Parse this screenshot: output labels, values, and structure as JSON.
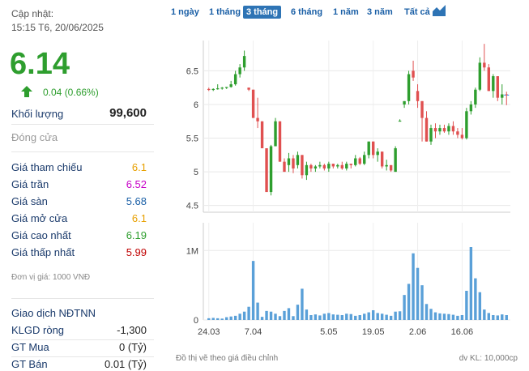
{
  "header": {
    "updated_label": "Cập nhật:",
    "updated_time": "15:15 T6, 20/06/2025",
    "price": "6.14",
    "change": "0.04 (0.66%)",
    "change_color": "#2e9e2e"
  },
  "volume": {
    "label": "Khối lượng",
    "value": "99,600"
  },
  "close_label": "Đóng cửa",
  "prices": [
    {
      "label": "Giá tham chiếu",
      "value": "6.1",
      "color": "#e8a000"
    },
    {
      "label": "Giá trần",
      "value": "6.52",
      "color": "#c800c8"
    },
    {
      "label": "Giá sàn",
      "value": "5.68",
      "color": "#1a5fa6"
    },
    {
      "label": "Giá mở cửa",
      "value": "6.1",
      "color": "#e8a000"
    },
    {
      "label": "Giá cao nhất",
      "value": "6.19",
      "color": "#2e9e2e"
    },
    {
      "label": "Giá thấp nhất",
      "value": "5.99",
      "color": "#c00000"
    }
  ],
  "unit_note": "Đơn vị giá: 1000 VNĐ",
  "foreign": {
    "title": "Giao dịch NĐTNN",
    "rows": [
      {
        "label": "KLGD ròng",
        "value": "-1,300"
      },
      {
        "label": "GT Mua",
        "value": "0 (Tỷ)"
      },
      {
        "label": "GT Bán",
        "value": "0.01 (Tỷ)"
      }
    ]
  },
  "tabs": [
    "1 ngày",
    "1 tháng",
    "3 tháng",
    "6 tháng",
    "1 năm",
    "3 năm",
    "Tất cả"
  ],
  "active_tab": "3 tháng",
  "chart_icon": "area-chart-icon",
  "footer": {
    "left": "Đồ thị vẽ theo giá điều chỉnh",
    "right": "dv KL: 10,000cp"
  },
  "colors": {
    "up": "#2e9e2e",
    "down": "#e05050",
    "ref": "#1a8cff",
    "volume": "#5aa0d8"
  },
  "chart_data": {
    "type": "candlestick",
    "price_axis": {
      "ticks": [
        "6.5",
        "6",
        "5.5",
        "5",
        "4.5"
      ],
      "tick_values": [
        6.5,
        6,
        5.5,
        5,
        4.5
      ],
      "ylim": [
        4.4,
        6.95
      ]
    },
    "volume_axis": {
      "ticks": [
        "1M",
        "0"
      ],
      "tick_values": [
        10000,
        0
      ],
      "ylim": [
        0,
        14000
      ]
    },
    "x_ticks": [
      {
        "label": "24.03",
        "index": 0
      },
      {
        "label": "7.04",
        "index": 10
      },
      {
        "label": "5.05",
        "index": 27
      },
      {
        "label": "19.05",
        "index": 37
      },
      {
        "label": "2.06",
        "index": 47
      },
      {
        "label": "16.06",
        "index": 57
      }
    ],
    "candles": [
      [
        6.23,
        6.25,
        6.2,
        6.22
      ],
      [
        6.22,
        6.24,
        6.2,
        6.23
      ],
      [
        6.23,
        6.3,
        6.22,
        6.24
      ],
      [
        6.24,
        6.26,
        6.22,
        6.25
      ],
      [
        6.25,
        6.26,
        6.23,
        6.26
      ],
      [
        6.26,
        6.35,
        6.25,
        6.3
      ],
      [
        6.3,
        6.5,
        6.28,
        6.45
      ],
      [
        6.45,
        6.6,
        6.4,
        6.55
      ],
      [
        6.55,
        6.8,
        6.5,
        6.72
      ],
      [
        6.25,
        6.25,
        6.2,
        6.22
      ],
      [
        6.22,
        6.22,
        5.8,
        5.8
      ],
      [
        5.8,
        6.1,
        5.65,
        5.75
      ],
      [
        5.75,
        5.75,
        5.35,
        5.35
      ],
      [
        5.35,
        5.35,
        4.7,
        4.7
      ],
      [
        4.7,
        5.4,
        4.65,
        5.38
      ],
      [
        5.38,
        5.8,
        5.38,
        5.75
      ],
      [
        5.75,
        5.75,
        5.15,
        5.15
      ],
      [
        5.15,
        5.2,
        5.0,
        5.0
      ],
      [
        5.1,
        5.28,
        5.0,
        5.2
      ],
      [
        5.2,
        5.25,
        4.98,
        5.05
      ],
      [
        5.1,
        5.3,
        5.05,
        5.25
      ],
      [
        5.25,
        5.25,
        4.9,
        4.95
      ],
      [
        4.95,
        5.15,
        4.88,
        5.1
      ],
      [
        5.1,
        5.12,
        5.0,
        5.05
      ],
      [
        5.05,
        5.1,
        5.0,
        5.08
      ],
      [
        5.08,
        5.15,
        5.05,
        5.1
      ],
      [
        5.1,
        5.12,
        5.02,
        5.05
      ],
      [
        5.05,
        5.15,
        5.0,
        5.12
      ],
      [
        5.12,
        5.12,
        5.05,
        5.08
      ],
      [
        5.08,
        5.12,
        5.05,
        5.1
      ],
      [
        5.1,
        5.15,
        5.03,
        5.05
      ],
      [
        5.05,
        5.15,
        5.02,
        5.12
      ],
      [
        5.12,
        5.12,
        5.05,
        5.1
      ],
      [
        5.1,
        5.25,
        5.08,
        5.2
      ],
      [
        5.2,
        5.22,
        5.1,
        5.12
      ],
      [
        5.12,
        5.3,
        5.1,
        5.25
      ],
      [
        5.25,
        5.45,
        5.2,
        5.45
      ],
      [
        5.45,
        5.45,
        5.2,
        5.25
      ],
      [
        5.25,
        5.35,
        5.15,
        5.3
      ],
      [
        5.3,
        5.3,
        5.05,
        5.08
      ],
      [
        5.08,
        5.18,
        5.02,
        5.1
      ],
      [
        5.1,
        5.08,
        5.0,
        5.02
      ],
      [
        5.0,
        5.38,
        5.0,
        5.35
      ],
      [
        5.75,
        5.78,
        5.75,
        5.76
      ],
      [
        6.0,
        6.05,
        5.95,
        6.05
      ],
      [
        6.05,
        6.5,
        6.0,
        6.45
      ],
      [
        6.5,
        6.65,
        6.35,
        6.4
      ],
      [
        6.2,
        6.3,
        5.95,
        6.05
      ],
      [
        6.05,
        6.05,
        5.45,
        5.8
      ],
      [
        5.8,
        5.9,
        5.45,
        5.45
      ],
      [
        5.45,
        5.7,
        5.4,
        5.65
      ],
      [
        5.65,
        5.72,
        5.5,
        5.6
      ],
      [
        5.6,
        5.7,
        5.55,
        5.65
      ],
      [
        5.65,
        5.7,
        5.58,
        5.6
      ],
      [
        5.6,
        5.72,
        5.55,
        5.68
      ],
      [
        5.68,
        5.75,
        5.55,
        5.6
      ],
      [
        5.6,
        5.65,
        5.5,
        5.55
      ],
      [
        5.55,
        5.65,
        5.48,
        5.5
      ],
      [
        5.5,
        5.95,
        5.48,
        5.9
      ],
      [
        5.9,
        6.05,
        5.85,
        6.0
      ],
      [
        6.0,
        6.25,
        5.95,
        6.22
      ],
      [
        6.22,
        6.7,
        6.2,
        6.62
      ],
      [
        6.62,
        6.9,
        6.5,
        6.55
      ],
      [
        6.55,
        6.6,
        6.2,
        6.2
      ],
      [
        6.2,
        6.45,
        6.1,
        6.42
      ],
      [
        6.42,
        6.42,
        6.05,
        6.1
      ],
      [
        6.1,
        6.3,
        6.0,
        6.15
      ],
      [
        6.15,
        6.19,
        5.99,
        6.14
      ]
    ],
    "volumes": [
      250,
      300,
      250,
      200,
      400,
      500,
      600,
      900,
      1200,
      1900,
      8500,
      2500,
      450,
      1300,
      1200,
      900,
      550,
      1300,
      1700,
      550,
      2200,
      4500,
      1500,
      700,
      800,
      650,
      900,
      1000,
      800,
      750,
      700,
      900,
      850,
      600,
      700,
      900,
      1100,
      1400,
      1000,
      900,
      750,
      600,
      1200,
      1250,
      3600,
      5200,
      9600,
      7500,
      5000,
      2300,
      1600,
      1100,
      950,
      900,
      850,
      750,
      600,
      700,
      4200,
      10500,
      6000,
      4000,
      1500,
      1000,
      700,
      650,
      800,
      700
    ]
  }
}
